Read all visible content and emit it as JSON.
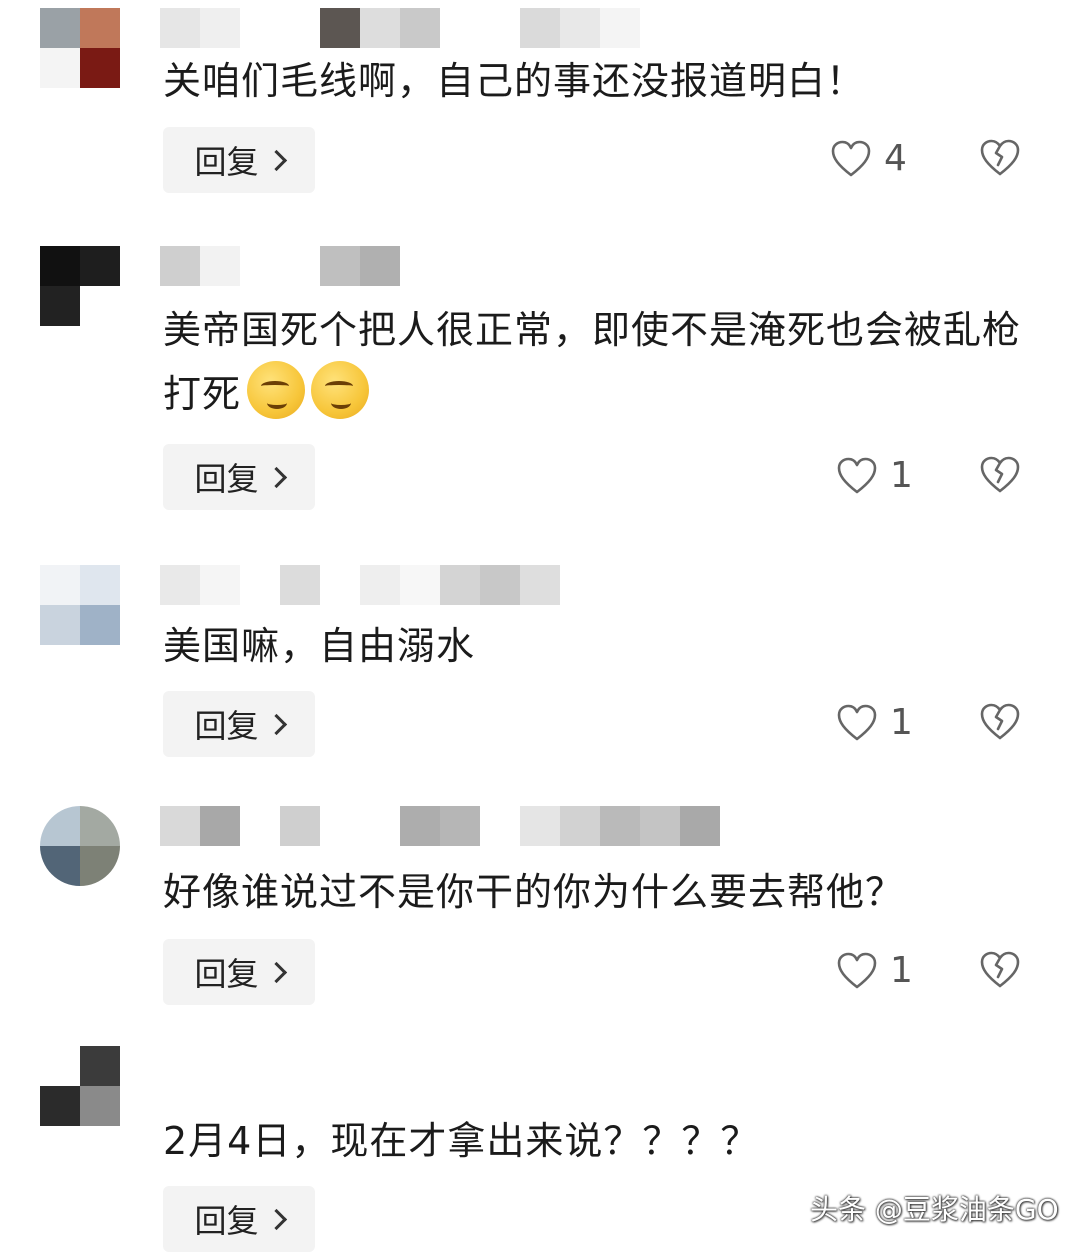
{
  "comments": [
    {
      "text": "关咱们毛线啊，自己的事还没报道明白！",
      "reply_label": "回复",
      "likes": "4",
      "avatar_colors": [
        "#9aa1a6",
        "#c0785a",
        "#f4f4f4",
        "#7a1a14"
      ],
      "name_colors": [
        "#e6e6e6",
        "#efefef",
        "#ffffff",
        "#5c5652",
        "#dddddd",
        "#c9c9c9",
        "#ffffff",
        "#dadada",
        "#e8e8e8",
        "#f4f4f4"
      ]
    },
    {
      "text": "美帝国死个把人很正常，即使不是淹死也会被乱枪打死",
      "emoji_count": 2,
      "emoji_name": "smirk-thumb-emoji",
      "reply_label": "回复",
      "likes": "1",
      "avatar_colors": [
        "#111111",
        "#1e1e1e",
        "#222222",
        "#ffffff"
      ],
      "name_colors": [
        "#cfcfcf",
        "#f2f2f2",
        "#ffffff",
        "#ffffff",
        "#bfbfbf",
        "#b0b0b0"
      ]
    },
    {
      "text": "美国嘛，自由溺水",
      "reply_label": "回复",
      "likes": "1",
      "avatar_colors": [
        "#f1f3f6",
        "#dfe6ee",
        "#c9d3de",
        "#9fb2c7"
      ],
      "name_colors": [
        "#e9e9e9",
        "#f5f5f5",
        "#ffffff",
        "#dcdcdc",
        "#ffffff",
        "#eeeeee",
        "#f7f7f7",
        "#d4d4d4",
        "#c8c8c8",
        "#dedede"
      ]
    },
    {
      "text": "好像谁说过不是你干的你为什么要去帮他？",
      "reply_label": "回复",
      "likes": "1",
      "avatar_colors": [
        "#b7c6d2",
        "#a3a9a2",
        "#526577",
        "#7d8176"
      ],
      "name_colors": [
        "#d9d9d9",
        "#a8a8a8",
        "#ffffff",
        "#cfcfcf",
        "#ffffff",
        "#ffffff",
        "#adadad",
        "#b6b6b6",
        "#ffffff",
        "#e5e5e5",
        "#d2d2d2",
        "#bababa",
        "#c4c4c4",
        "#a9a9a9"
      ]
    },
    {
      "text": "2月4日，现在才拿出来说？？？？",
      "reply_label": "回复",
      "avatar_colors": [
        "#ffffff",
        "#3b3b3b",
        "#2b2b2b",
        "#8a8a8a"
      ],
      "name_colors": []
    }
  ],
  "watermark": "头条 @豆浆油条GO",
  "icons": {
    "like": "heart-outline-icon",
    "dislike": "broken-heart-icon",
    "reply_arrow": "chevron-right-icon"
  }
}
